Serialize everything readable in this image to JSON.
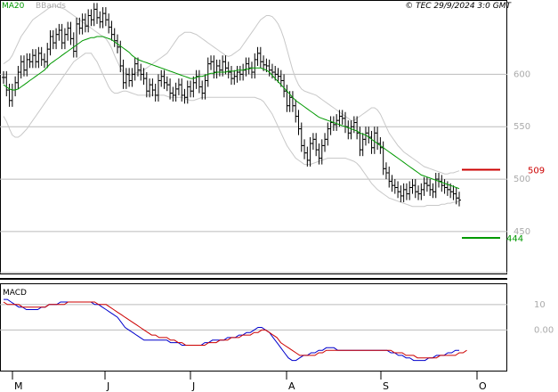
{
  "header": {
    "copyright": "© TEC 29/9/2024 3:0 GMT",
    "legend_ma": "MA20",
    "legend_bands": "BBands"
  },
  "colors": {
    "ma": "#009900",
    "bands": "#c8c8c8",
    "bars": "#000000",
    "resistance": "#cc0000",
    "support": "#009900",
    "macd": "#0000cc",
    "signal": "#cc0000",
    "grid": "#bbbbbb"
  },
  "chart_data": [
    {
      "type": "ohlc",
      "x": [
        "M",
        "J",
        "J",
        "A",
        "S",
        "O"
      ],
      "ylim": [
        410,
        670
      ],
      "yticks": [
        450,
        500,
        550,
        600
      ],
      "ytick_labels": [
        "450",
        "500",
        "550",
        "600"
      ],
      "close": [
        597,
        585,
        575,
        585,
        592,
        602,
        612,
        604,
        614,
        612,
        618,
        612,
        620,
        614,
        612,
        624,
        636,
        630,
        638,
        642,
        630,
        638,
        644,
        634,
        622,
        648,
        644,
        652,
        646,
        656,
        652,
        662,
        654,
        650,
        658,
        652,
        645,
        638,
        632,
        626,
        608,
        592,
        600,
        594,
        600,
        610,
        604,
        600,
        596,
        584,
        590,
        585,
        580,
        594,
        598,
        592,
        590,
        582,
        580,
        586,
        590,
        580,
        578,
        588,
        584,
        592,
        598,
        588,
        582,
        594,
        610,
        612,
        602,
        608,
        604,
        612,
        606,
        602,
        596,
        598,
        602,
        600,
        604,
        610,
        606,
        602,
        614,
        620,
        612,
        609,
        608,
        604,
        602,
        600,
        598,
        594,
        584,
        570,
        578,
        570,
        560,
        548,
        532,
        525,
        518,
        534,
        538,
        528,
        520,
        532,
        538,
        548,
        554,
        552,
        556,
        560,
        558,
        550,
        544,
        550,
        554,
        544,
        528,
        538,
        544,
        540,
        530,
        544,
        534,
        530,
        510,
        506,
        498,
        494,
        492,
        488,
        484,
        490,
        486,
        492,
        494,
        488,
        486,
        490,
        496,
        494,
        490,
        488,
        500,
        498,
        494,
        492,
        490,
        488,
        486,
        482,
        480
      ],
      "ma20": [
        590,
        588,
        586,
        585,
        585,
        586,
        588,
        590,
        592,
        594,
        596,
        598,
        600,
        602,
        604,
        607,
        610,
        612,
        614,
        616,
        618,
        620,
        622,
        624,
        626,
        628,
        630,
        632,
        633,
        634,
        635,
        635,
        636,
        636,
        636,
        635,
        634,
        633,
        631,
        629,
        627,
        625,
        623,
        621,
        618,
        616,
        614,
        613,
        612,
        611,
        610,
        609,
        608,
        607,
        606,
        605,
        604,
        603,
        602,
        601,
        600,
        599,
        598,
        597,
        596,
        596,
        597,
        598,
        598,
        599,
        600,
        601,
        601,
        602,
        602,
        602,
        602,
        603,
        603,
        603,
        604,
        604,
        604,
        605,
        605,
        606,
        606,
        606,
        606,
        605,
        604,
        602,
        599,
        596,
        593,
        590,
        587,
        584,
        581,
        578,
        575,
        573,
        571,
        569,
        567,
        565,
        563,
        561,
        559,
        558,
        557,
        556,
        555,
        554,
        553,
        552,
        551,
        550,
        549,
        548,
        547,
        546,
        544,
        543,
        542,
        540,
        538,
        536,
        534,
        532,
        530,
        528,
        526,
        524,
        522,
        520,
        518,
        516,
        514,
        512,
        510,
        508,
        506,
        504,
        503,
        502,
        501,
        500,
        499,
        498,
        497,
        496,
        495,
        494,
        493,
        492,
        491
      ],
      "bb_upper": [
        610,
        612,
        614,
        618,
        624,
        630,
        636,
        640,
        644,
        648,
        652,
        654,
        656,
        658,
        660,
        662,
        664,
        665,
        665,
        664,
        663,
        662,
        660,
        658,
        656,
        654,
        652,
        650,
        648,
        646,
        644,
        642,
        640,
        638,
        636,
        634,
        630,
        625,
        618,
        612,
        606,
        602,
        600,
        599,
        600,
        601,
        602,
        603,
        604,
        606,
        608,
        610,
        612,
        614,
        616,
        618,
        620,
        624,
        628,
        632,
        636,
        638,
        640,
        640,
        640,
        639,
        638,
        636,
        634,
        632,
        630,
        628,
        626,
        624,
        622,
        620,
        618,
        617,
        618,
        620,
        622,
        624,
        628,
        632,
        636,
        640,
        644,
        648,
        652,
        654,
        656,
        656,
        655,
        652,
        648,
        642,
        634,
        624,
        614,
        604,
        596,
        590,
        586,
        584,
        583,
        582,
        581,
        580,
        578,
        576,
        574,
        572,
        570,
        568,
        566,
        564,
        562,
        560,
        558,
        556,
        556,
        558,
        560,
        562,
        564,
        566,
        568,
        568,
        566,
        562,
        556,
        550,
        544,
        540,
        536,
        532,
        529,
        526,
        524,
        522,
        520,
        518,
        516,
        514,
        512,
        511,
        510,
        509,
        508,
        507,
        506,
        505,
        505,
        506,
        506,
        507,
        508
      ],
      "bb_lower": [
        560,
        555,
        548,
        542,
        540,
        540,
        542,
        545,
        548,
        552,
        556,
        560,
        564,
        568,
        572,
        576,
        580,
        584,
        588,
        592,
        596,
        600,
        604,
        608,
        612,
        614,
        616,
        618,
        620,
        620,
        620,
        616,
        612,
        606,
        600,
        594,
        588,
        584,
        582,
        582,
        583,
        584,
        584,
        583,
        582,
        581,
        580,
        580,
        580,
        580,
        580,
        580,
        580,
        580,
        580,
        580,
        579,
        578,
        578,
        578,
        578,
        578,
        577,
        576,
        575,
        575,
        576,
        577,
        578,
        578,
        578,
        578,
        578,
        578,
        578,
        578,
        578,
        578,
        578,
        578,
        578,
        578,
        578,
        578,
        578,
        578,
        578,
        577,
        576,
        574,
        570,
        566,
        562,
        556,
        550,
        544,
        538,
        532,
        528,
        524,
        520,
        518,
        516,
        514,
        514,
        514,
        515,
        516,
        517,
        518,
        519,
        520,
        520,
        520,
        520,
        520,
        520,
        520,
        519,
        518,
        517,
        515,
        512,
        508,
        504,
        500,
        496,
        493,
        490,
        488,
        486,
        484,
        482,
        481,
        480,
        479,
        478,
        477,
        476,
        475,
        474,
        474,
        474,
        474,
        474,
        475,
        475,
        475,
        475,
        475,
        476,
        476,
        477,
        477,
        478,
        478,
        479
      ],
      "resistance": 509,
      "support": 444,
      "resistance_label": "509",
      "support_label": "444",
      "grid": true
    },
    {
      "type": "line",
      "title": "MACD",
      "ylim": [
        -16,
        18
      ],
      "yticks": [
        0,
        10
      ],
      "ytick_labels": [
        "0.00",
        "10"
      ],
      "series": [
        {
          "values": [
            12,
            12,
            11,
            10,
            9,
            9,
            8,
            8,
            8,
            8,
            9,
            9,
            10,
            10,
            10,
            11,
            11,
            11,
            11,
            11,
            11,
            11,
            11,
            11,
            10,
            10,
            9,
            8,
            7,
            6,
            5,
            3,
            1,
            0,
            -1,
            -2,
            -3,
            -4,
            -4,
            -4,
            -4,
            -4,
            -4,
            -4,
            -5,
            -5,
            -5,
            -6,
            -6,
            -6,
            -6,
            -6,
            -6,
            -5,
            -5,
            -4,
            -4,
            -4,
            -4,
            -3,
            -3,
            -3,
            -2,
            -2,
            -1,
            -1,
            0,
            1,
            1,
            0,
            -1,
            -3,
            -5,
            -7,
            -9,
            -11,
            -12,
            -12,
            -11,
            -10,
            -10,
            -9,
            -9,
            -8,
            -8,
            -7,
            -7,
            -7,
            -8,
            -8,
            -8,
            -8,
            -8,
            -8,
            -8,
            -8,
            -8,
            -8,
            -8,
            -8,
            -8,
            -8,
            -9,
            -9,
            -10,
            -10,
            -11,
            -11,
            -12,
            -12,
            -12,
            -12,
            -11,
            -11,
            -10,
            -10,
            -10,
            -9,
            -9,
            -8,
            -8
          ]
        },
        {
          "values": [
            11,
            10,
            10,
            10,
            10,
            9,
            9,
            9,
            9,
            9,
            9,
            9,
            10,
            10,
            10,
            10,
            10,
            11,
            11,
            11,
            11,
            11,
            11,
            11,
            11,
            10,
            10,
            10,
            9,
            8,
            7,
            6,
            5,
            4,
            3,
            2,
            1,
            0,
            -1,
            -2,
            -2,
            -3,
            -3,
            -3,
            -4,
            -4,
            -5,
            -5,
            -6,
            -6,
            -6,
            -6,
            -6,
            -6,
            -5,
            -5,
            -5,
            -4,
            -4,
            -4,
            -3,
            -3,
            -3,
            -2,
            -2,
            -2,
            -1,
            -1,
            0,
            0,
            -1,
            -2,
            -3,
            -5,
            -6,
            -7,
            -8,
            -9,
            -10,
            -10,
            -10,
            -10,
            -10,
            -9,
            -9,
            -8,
            -8,
            -8,
            -8,
            -8,
            -8,
            -8,
            -8,
            -8,
            -8,
            -8,
            -8,
            -8,
            -8,
            -8,
            -8,
            -8,
            -8,
            -9,
            -9,
            -9,
            -10,
            -10,
            -10,
            -11,
            -11,
            -11,
            -11,
            -11,
            -11,
            -10,
            -10,
            -10,
            -10,
            -10,
            -9,
            -9,
            -8
          ]
        }
      ]
    }
  ]
}
